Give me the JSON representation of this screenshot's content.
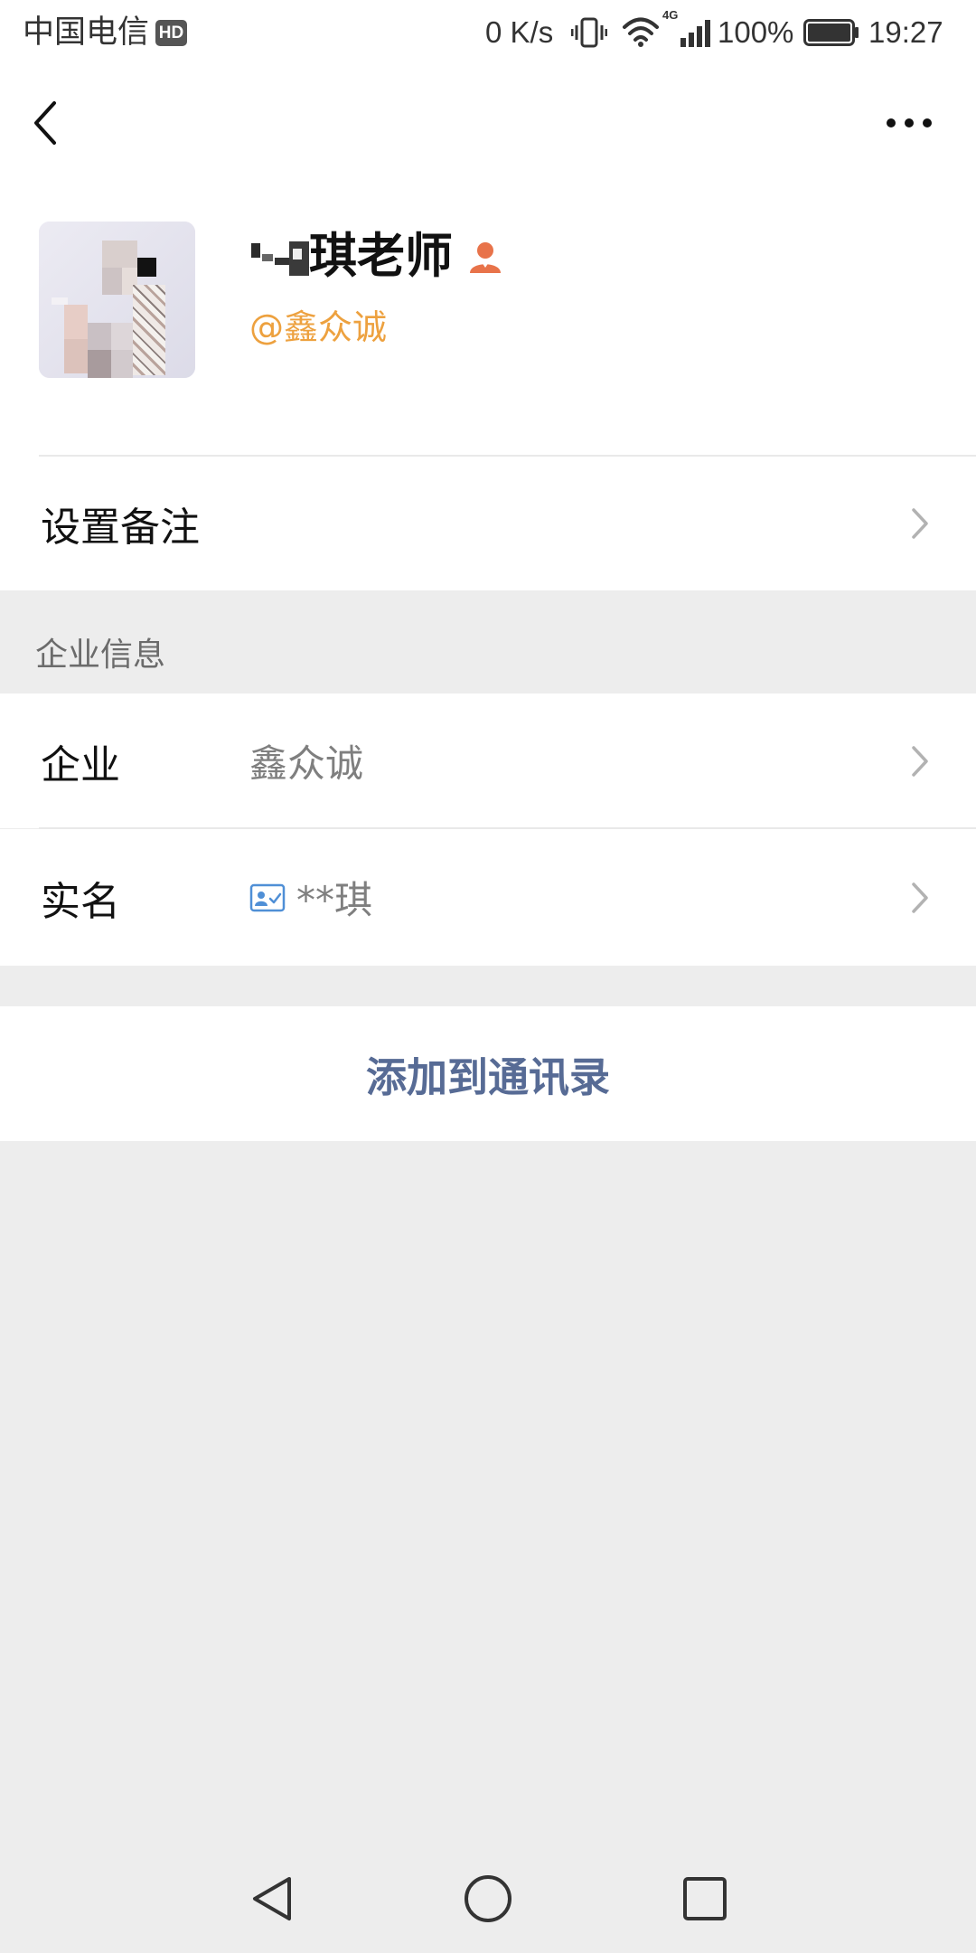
{
  "status_bar": {
    "carrier": "中国电信",
    "hd_badge": "HD",
    "net_speed": "0 K/s",
    "network_type": "4G",
    "battery_level": "100%",
    "time": "19:27",
    "icons": {
      "vibrate": "vibrate-icon",
      "wifi": "wifi-icon",
      "signal": "signal-bars-icon",
      "battery": "battery-full-icon"
    }
  },
  "header": {
    "back_icon": "chevron-left-icon",
    "more_icon": "more-horizontal-icon"
  },
  "profile": {
    "name": "琪老师",
    "handle": "@鑫众诚",
    "badge_icon": "person-icon"
  },
  "rows": {
    "remark": {
      "label": "设置备注",
      "chevron_icon": "chevron-right-icon"
    },
    "section_title": "企业信息",
    "company": {
      "label": "企业",
      "value": "鑫众诚"
    },
    "real_name": {
      "label": "实名",
      "value": "**琪",
      "verified_icon": "id-card-verified-icon"
    }
  },
  "actions": {
    "add_to_contacts": "添加到通讯录"
  },
  "nav_bar": {
    "back_icon": "nav-back-triangle-icon",
    "home_icon": "nav-home-circle-icon",
    "recents_icon": "nav-recents-square-icon"
  },
  "colors": {
    "page_background": "#ededed",
    "link_blue": "#576b95",
    "handle_orange": "#eda13f",
    "badge_orange": "#e8734a",
    "id_icon_blue": "#4f8fd6",
    "chevron_gray": "#b2b2b2"
  }
}
